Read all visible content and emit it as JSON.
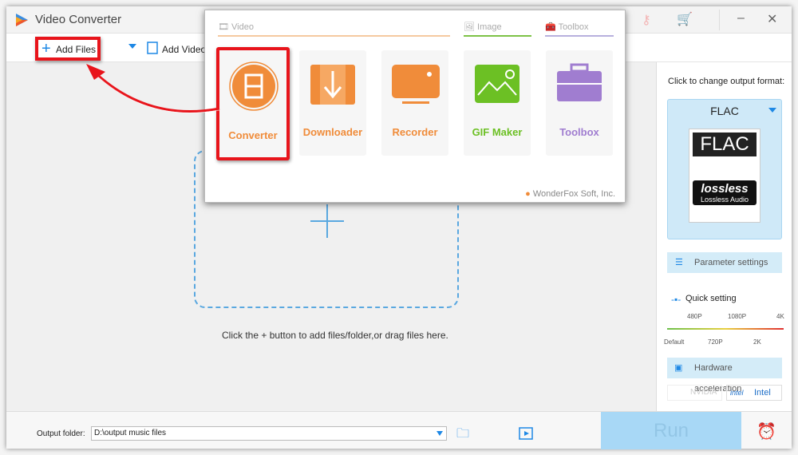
{
  "app": {
    "title": "Video Converter"
  },
  "toolbar": {
    "add_files": "Add Files",
    "add_video": "Add Video"
  },
  "popup": {
    "sections": [
      {
        "label": "Video",
        "color": "#f5a15a"
      },
      {
        "label": "Image",
        "color": "#7dc246"
      },
      {
        "label": "Toolbox",
        "color": "#a99ad8"
      }
    ],
    "tiles": [
      {
        "label": "Converter",
        "color": "#f08c3a",
        "icon": "film-convert-icon"
      },
      {
        "label": "Downloader",
        "color": "#f08c3a",
        "icon": "download-film-icon"
      },
      {
        "label": "Recorder",
        "color": "#f08c3a",
        "icon": "screen-record-icon"
      },
      {
        "label": "GIF Maker",
        "color": "#6cc024",
        "icon": "image-mountain-icon"
      },
      {
        "label": "Toolbox",
        "color": "#a07dd0",
        "icon": "toolbox-icon"
      }
    ],
    "footer": "WonderFox Soft, Inc."
  },
  "main": {
    "hint": "Click the + button to add files/folder,or drag files here."
  },
  "right": {
    "caption": "Click to change output format:",
    "format": "FLAC",
    "badge_top": "FLAC",
    "badge_logo": "lossless",
    "badge_sub": "Lossless Audio",
    "parameter_settings": "Parameter settings",
    "quick_setting": "Quick setting",
    "ticks_top": [
      "480P",
      "1080P",
      "4K"
    ],
    "ticks_bottom": [
      "Default",
      "720P",
      "2K"
    ],
    "hardware": "Hardware acceleration",
    "nvidia": "NVIDIA",
    "intel": "Intel"
  },
  "bottom": {
    "output_label": "Output folder:",
    "output_value": "D:\\output music files",
    "run": "Run"
  }
}
